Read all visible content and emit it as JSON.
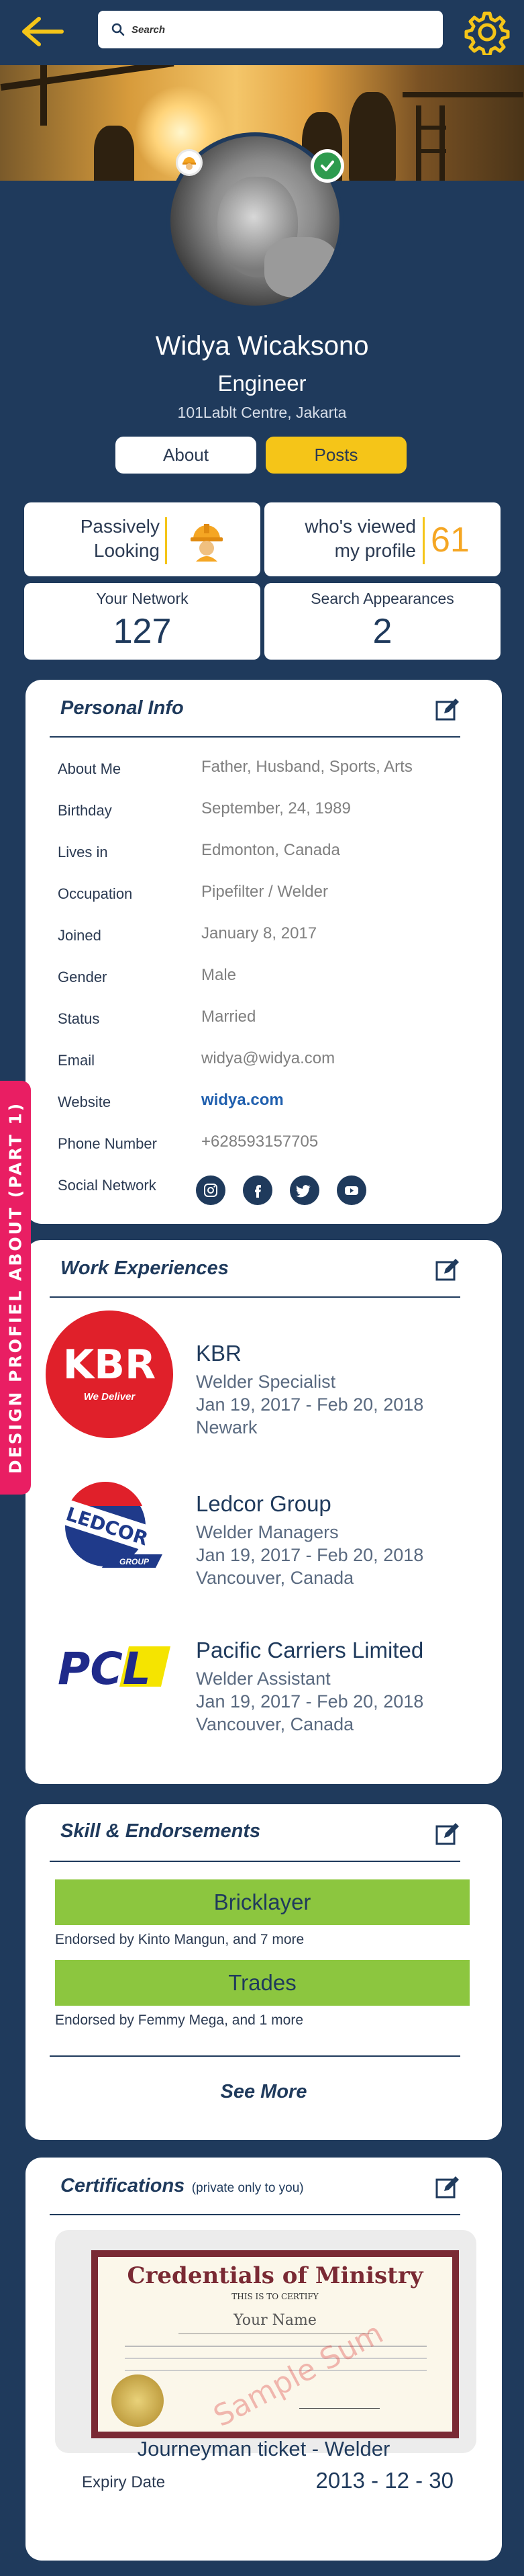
{
  "search": {
    "placeholder": "Search"
  },
  "profile": {
    "name": "Widya Wicaksono",
    "role": "Engineer",
    "location": "101Lablt Centre, Jakarta"
  },
  "tabs": {
    "about": "About",
    "posts": "Posts"
  },
  "stats": {
    "status_line1": "Passively",
    "status_line2": "Looking",
    "viewed_line1": "who's viewed",
    "viewed_line2": "my profile",
    "viewed_count": "61",
    "network_label": "Your Network",
    "network_count": "127",
    "search_label": "Search Appearances",
    "search_count": "2"
  },
  "personal_info": {
    "title": "Personal Info",
    "rows": [
      {
        "label": "About Me",
        "value": "Father, Husband, Sports, Arts"
      },
      {
        "label": "Birthday",
        "value": "September, 24, 1989"
      },
      {
        "label": "Lives in",
        "value": "Edmonton, Canada"
      },
      {
        "label": "Occupation",
        "value": "Pipefilter / Welder"
      },
      {
        "label": "Joined",
        "value": "January 8, 2017"
      },
      {
        "label": "Gender",
        "value": "Male"
      },
      {
        "label": "Status",
        "value": "Married"
      },
      {
        "label": "Email",
        "value": "widya@widya.com"
      },
      {
        "label": "Website",
        "value": "widya.com"
      },
      {
        "label": "Phone Number",
        "value": "+628593157705"
      },
      {
        "label": "Social Network",
        "value": ""
      }
    ],
    "social_icons": [
      "instagram-icon",
      "facebook-icon",
      "twitter-icon",
      "youtube-icon"
    ]
  },
  "work": {
    "title": "Work Experiences",
    "jobs": [
      {
        "company": "KBR",
        "logo_text": "KBR",
        "logo_tagline": "We Deliver",
        "position": "Welder Specialist",
        "dates": "Jan 19, 2017 - Feb 20, 2018",
        "place": "Newark"
      },
      {
        "company": "Ledcor Group",
        "logo_text": "LEDCOR",
        "logo_tagline": "GROUP",
        "position": "Welder Managers",
        "dates": "Jan 19, 2017 - Feb 20, 2018",
        "place": "Vancouver, Canada"
      },
      {
        "company": "Pacific Carriers Limited",
        "logo_text": "PCL",
        "logo_tagline": "",
        "position": "Welder Assistant",
        "dates": "Jan 19, 2017 - Feb 20, 2018",
        "place": "Vancouver, Canada"
      }
    ]
  },
  "skills": {
    "title": "Skill & Endorsements",
    "items": [
      {
        "name": "Bricklayer",
        "endorsed": "Endorsed by Kinto Mangun, and 7 more"
      },
      {
        "name": "Trades",
        "endorsed": "Endorsed by Femmy Mega, and 1 more"
      }
    ],
    "see_more": "See More"
  },
  "certifications": {
    "title": "Certifications",
    "note": "(private only to you)",
    "cert_heading": "Credentials of Ministry",
    "cert_sub": "THIS IS TO CERTIFY",
    "cert_name": "Your Name",
    "cert_watermark": "Sample Sum",
    "name": "Journeyman ticket - Welder",
    "expiry_label": "Expiry Date",
    "expiry_value": "2013 - 12 - 30"
  },
  "side_label": "DESIGN PROFIEL ABOUT (PART 1)",
  "colors": {
    "navy": "#1f3a5c",
    "yellow": "#f5c518",
    "green": "#8cc63f",
    "pink": "#e91e63",
    "kbr_red": "#e0202a"
  }
}
